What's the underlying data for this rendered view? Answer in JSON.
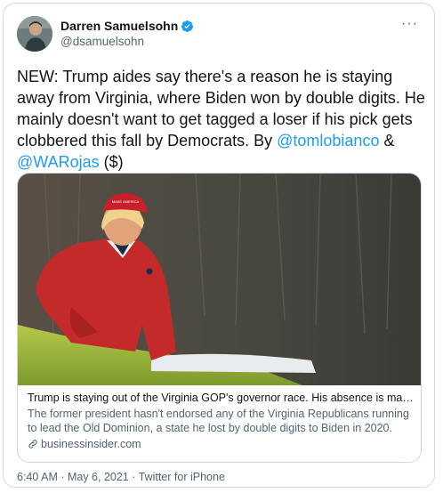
{
  "author": {
    "display_name": "Darren Samuelsohn",
    "handle": "@dsamuelsohn",
    "verified": true
  },
  "tweet": {
    "text_main": "NEW: Trump aides say there's a reason he is staying away from Virginia, where Biden won by double digits. He mainly doesn't want to get tagged a loser if his pick gets clobbered this fall by Democrats. By ",
    "mention_1": "@tomlobianco",
    "connector": " & ",
    "mention_2": "@WARojas",
    "suffix": " ($)"
  },
  "card": {
    "title": "Trump is staying out of the Virginia GOP's governor race. His absence is making...",
    "description": "The former president hasn't endorsed any of the Virginia Republicans running to lead the Old Dominion, a state he lost by double digits to Biden in 2020.",
    "domain": "businessinsider.com",
    "image_alt": "Man in red sweater and red cap standing on a golf course",
    "hat_text": "MAKE AMERICA GREAT AGAIN"
  },
  "footer": {
    "timestamp": "6:40 AM · May 6, 2021 · Twitter for iPhone"
  },
  "icons": {
    "verified": "verified-badge-icon",
    "more": "more-options-icon",
    "link": "link-icon"
  },
  "colors": {
    "accent": "#1d9bf0",
    "text": "#0f1419",
    "secondary": "#536471",
    "border": "#cfd9de"
  }
}
